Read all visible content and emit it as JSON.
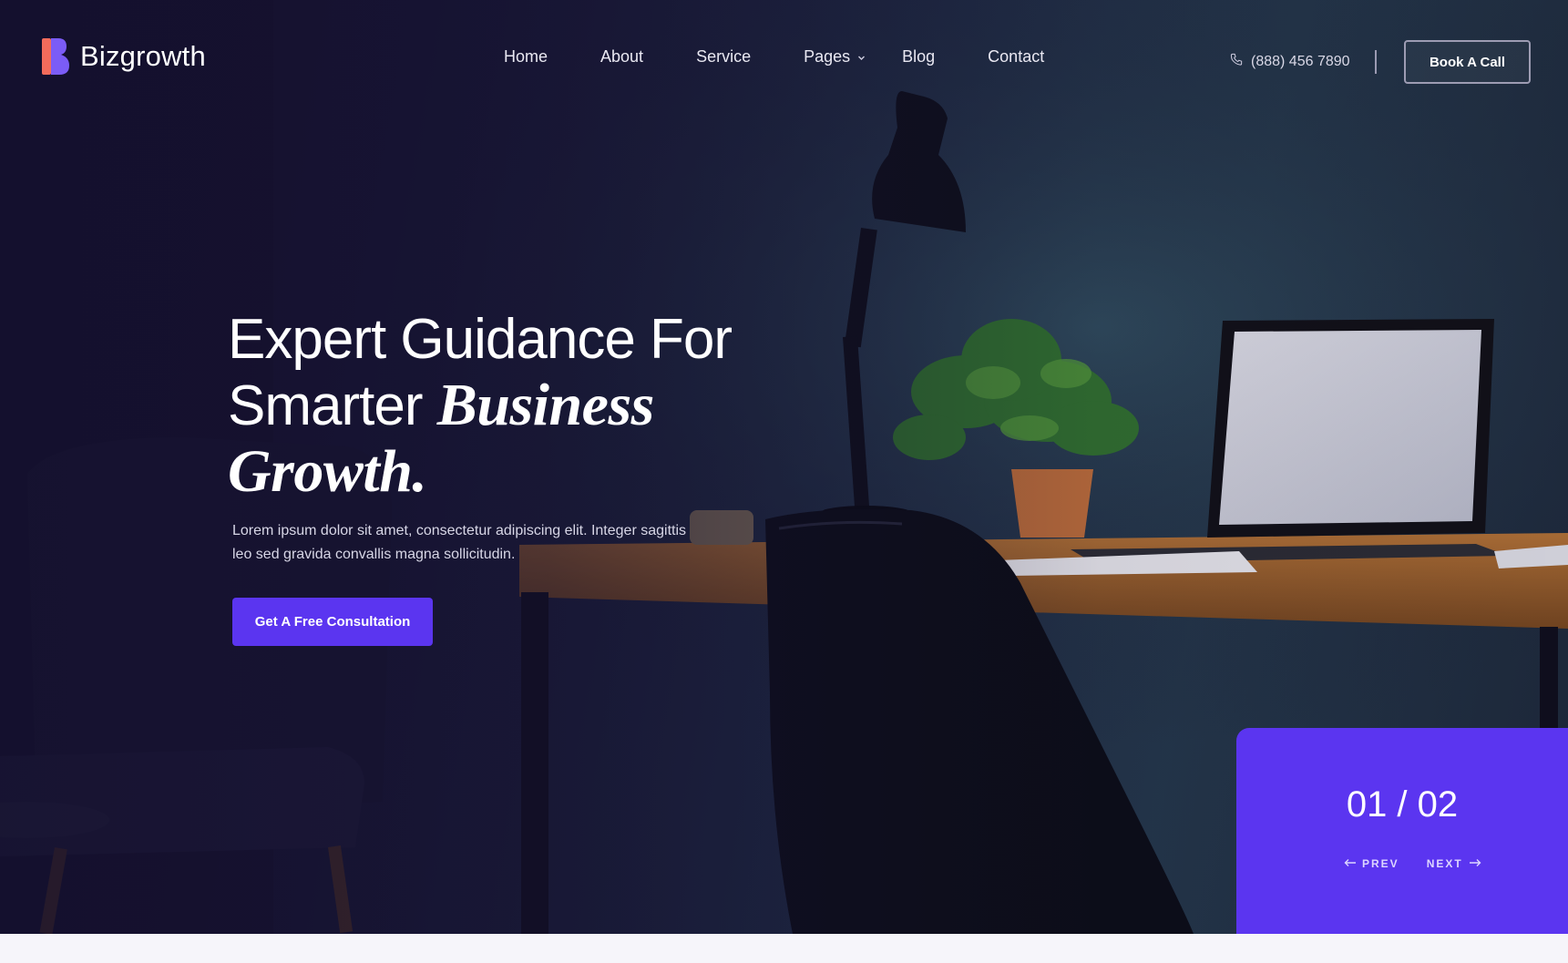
{
  "brand": {
    "name": "Bizgrowth",
    "accent": "#5b35f0",
    "logo_icon": "b-logo-icon"
  },
  "nav": {
    "items": [
      {
        "label": "Home"
      },
      {
        "label": "About"
      },
      {
        "label": "Service"
      },
      {
        "label": "Pages",
        "dropdown": true
      },
      {
        "label": "Blog"
      },
      {
        "label": "Contact"
      }
    ]
  },
  "header": {
    "phone": "(888) 456 7890",
    "phone_icon": "phone-icon",
    "book_label": "Book A Call"
  },
  "hero": {
    "line1": "Expert Guidance For",
    "line2_plain": "Smarter ",
    "line2_italic": "Business",
    "line3_italic": "Growth.",
    "description": "Lorem ipsum dolor sit amet, consectetur adipiscing elit. Integer sagittis leo sed gravida convallis magna sollicitudin.",
    "cta_label": "Get A Free Consultation"
  },
  "slider": {
    "counter": "01 / 02",
    "prev_label": "PREV",
    "next_label": "NEXT"
  }
}
